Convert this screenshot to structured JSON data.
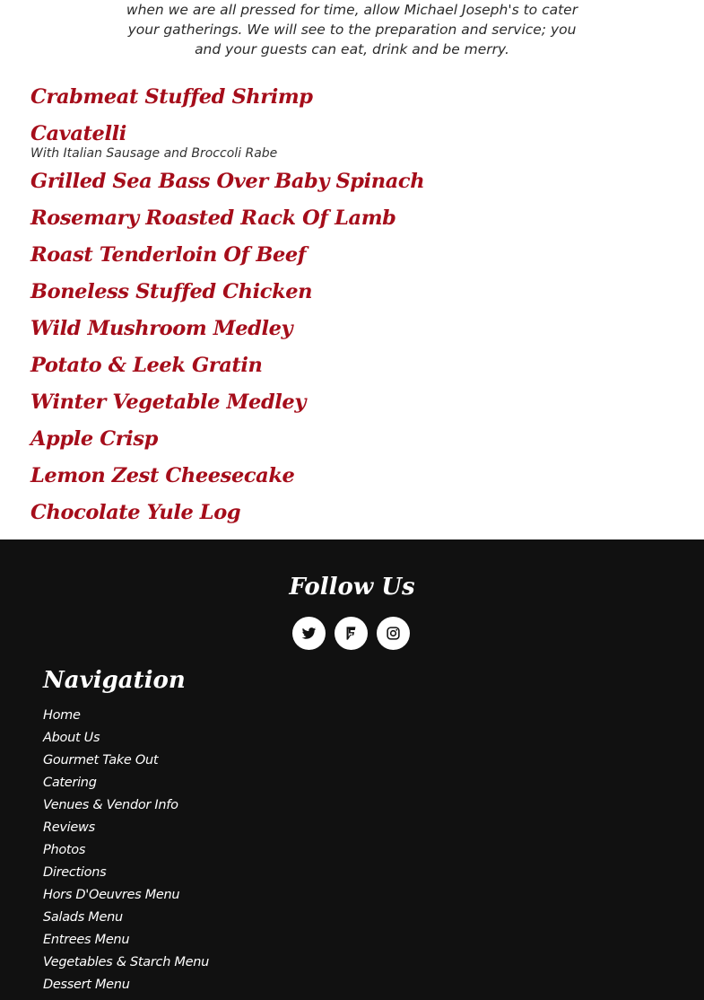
{
  "intro": {
    "lines": [
      "when we are all pressed for time, allow Michael Joseph's to cater",
      "your gatherings. We will see to the preparation and service; you",
      "and your guests can eat, drink and be merry."
    ]
  },
  "menu": {
    "items": [
      {
        "name": "Crabmeat Stuffed Shrimp"
      },
      {
        "name": "Cavatelli",
        "description": "With Italian Sausage and Broccoli Rabe"
      },
      {
        "name": "Grilled Sea Bass Over Baby Spinach"
      },
      {
        "name": "Rosemary Roasted Rack Of Lamb"
      },
      {
        "name": "Roast Tenderloin Of Beef"
      },
      {
        "name": "Boneless Stuffed Chicken"
      },
      {
        "name": "Wild Mushroom Medley"
      },
      {
        "name": "Potato & Leek Gratin"
      },
      {
        "name": "Winter Vegetable Medley"
      },
      {
        "name": "Apple Crisp"
      },
      {
        "name": "Lemon Zest Cheesecake"
      },
      {
        "name": "Chocolate Yule Log"
      }
    ],
    "accent_color": "#a50d1a"
  },
  "footer": {
    "follow_title": "Follow Us",
    "socials": [
      {
        "icon": "twitter-icon"
      },
      {
        "icon": "foursquare-icon"
      },
      {
        "icon": "instagram-icon"
      }
    ],
    "nav_title": "Navigation",
    "nav_items": [
      "Home",
      "About Us",
      "Gourmet Take Out",
      "Catering",
      "Venues & Vendor Info",
      "Reviews",
      "Photos",
      "Directions",
      "Hors D'Oeuvres Menu",
      "Salads Menu",
      "Entrees Menu",
      "Vegetables & Starch Menu",
      "Dessert Menu"
    ],
    "background_color": "#111111"
  }
}
